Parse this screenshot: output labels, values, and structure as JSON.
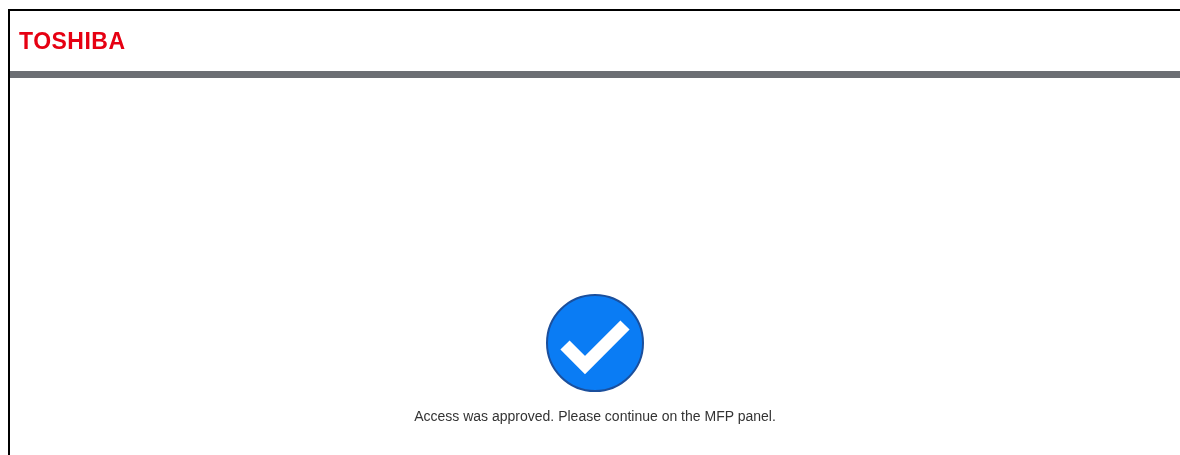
{
  "header": {
    "logo": "TOSHIBA"
  },
  "status": {
    "kind": "success",
    "message": "Access was approved. Please continue on the MFP panel."
  }
}
